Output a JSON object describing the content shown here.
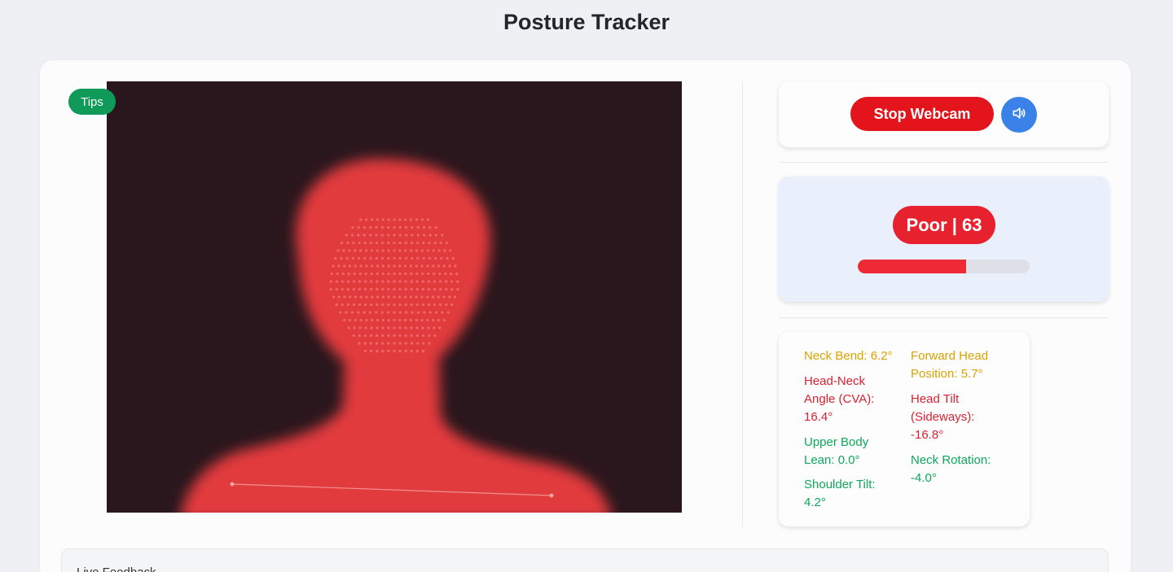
{
  "page": {
    "title": "Posture Tracker"
  },
  "video": {
    "tips_label": "Tips"
  },
  "controls": {
    "stop_label": "Stop Webcam",
    "sound_icon": "speaker-icon",
    "stop_color": "#e3141b",
    "sound_color": "#3b82e8"
  },
  "score": {
    "label": "Poor | 63",
    "progress_percent": 63,
    "color": "#e8212e"
  },
  "metrics": [
    {
      "text": "Neck Bend: 6.2°",
      "status": "warning",
      "color": "#d9a300"
    },
    {
      "text": "Forward Head Position: 5.7°",
      "status": "warning",
      "color": "#d9a300"
    },
    {
      "text": "Head-Neck Angle (CVA): 16.4°",
      "status": "bad",
      "color": "#d92130"
    },
    {
      "text": "Head Tilt (Sideways): -16.8°",
      "status": "bad",
      "color": "#d92130"
    },
    {
      "text": "Upper Body Lean: 0.0°",
      "status": "good",
      "color": "#0ea859"
    },
    {
      "text": "Neck Rotation: -4.0°",
      "status": "good",
      "color": "#0ea859"
    },
    {
      "text": "Shoulder Tilt: 4.2°",
      "status": "good",
      "color": "#0ea859"
    }
  ],
  "feedback": {
    "title": "Live Feedback"
  }
}
